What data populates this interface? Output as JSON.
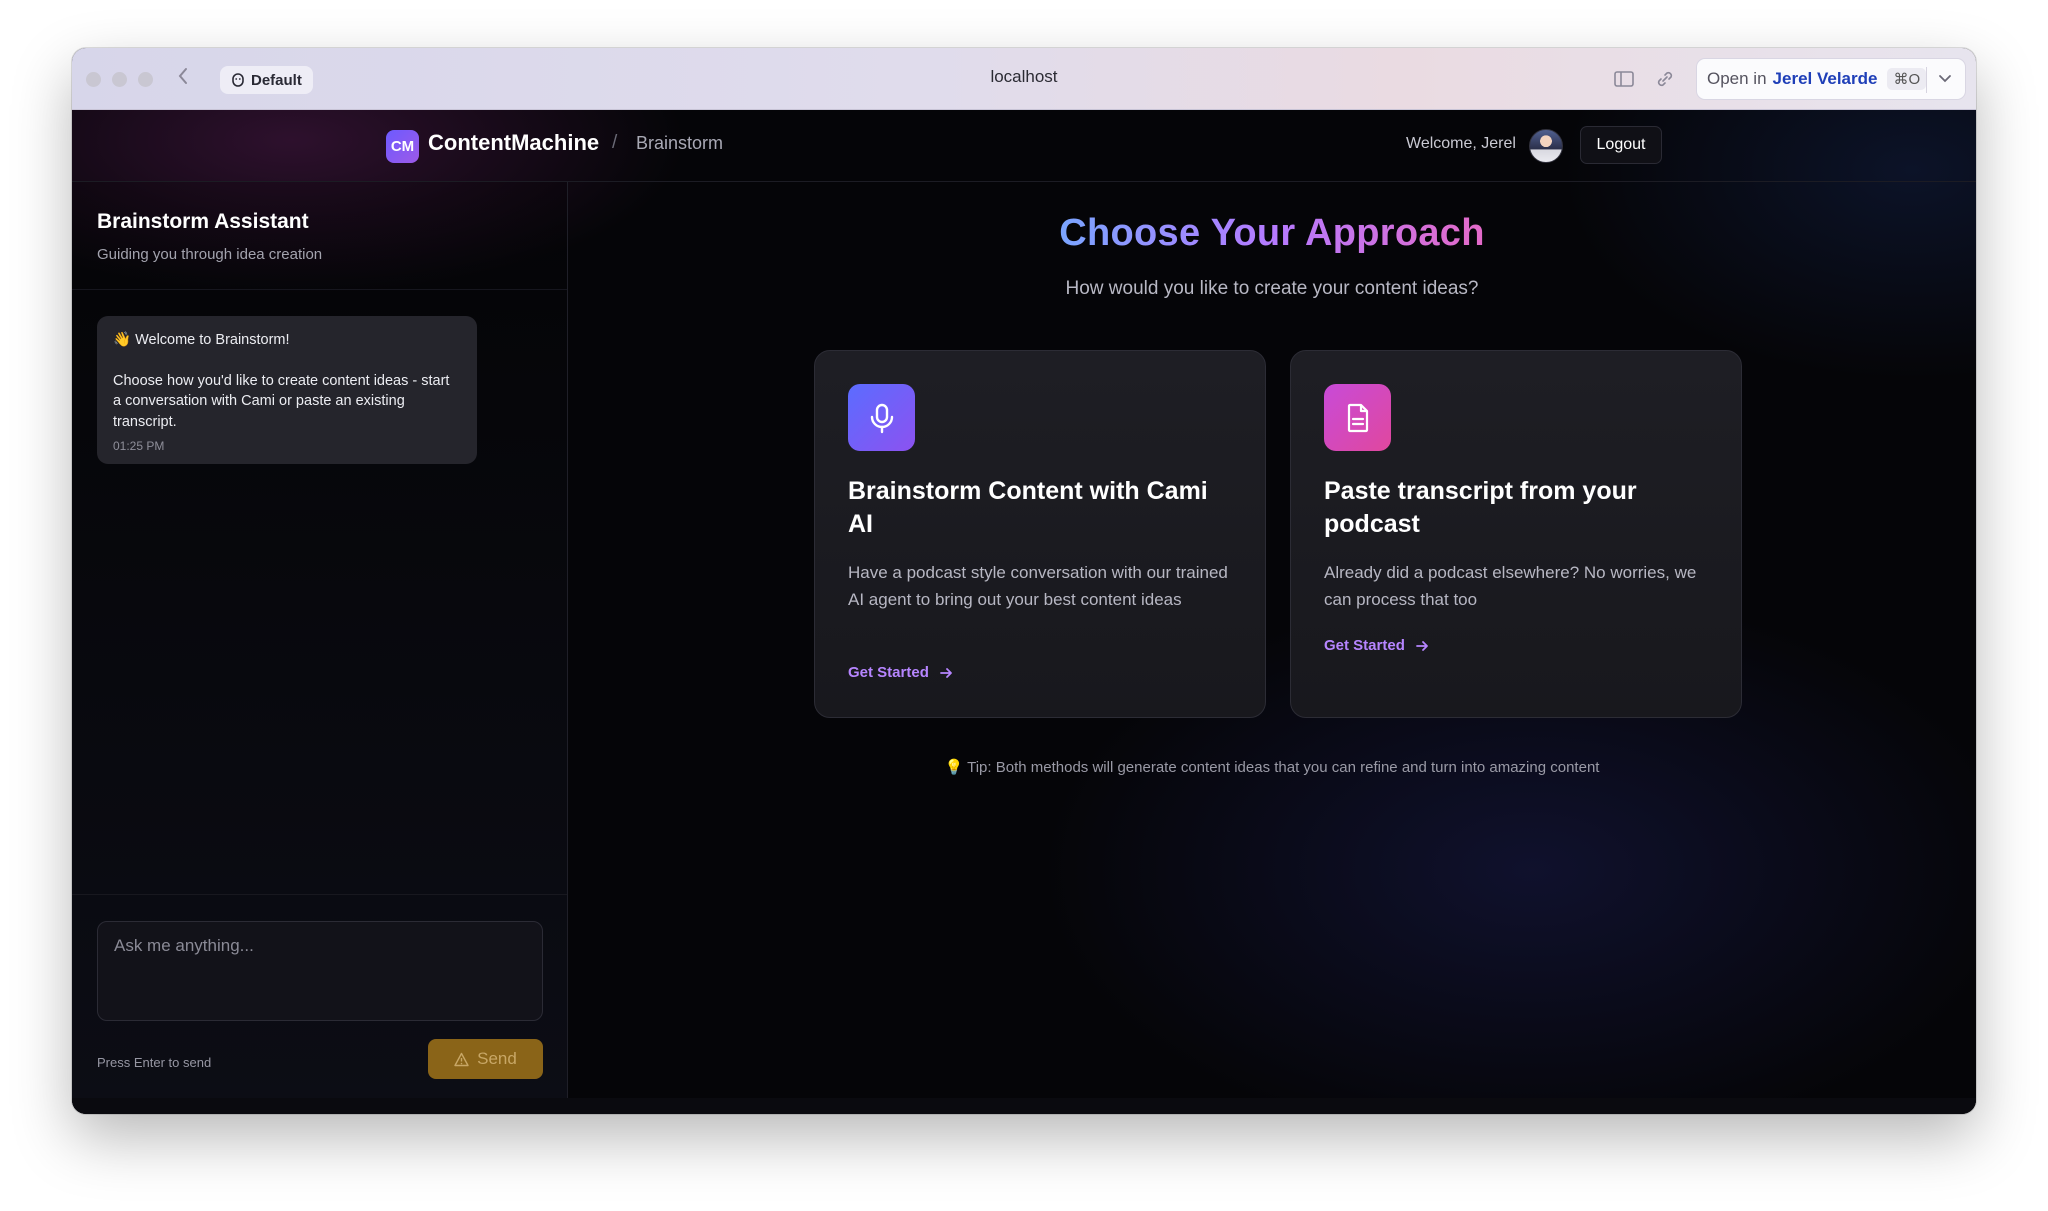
{
  "browser": {
    "profile_label": "Default",
    "url": "localhost",
    "open_in_prefix": "Open in",
    "open_in_name": "Jerel Velarde",
    "open_in_shortcut": "⌘O"
  },
  "header": {
    "logo_text": "CM",
    "brand": "ContentMachine",
    "separator": "/",
    "crumb": "Brainstorm",
    "welcome": "Welcome, Jerel",
    "logout_label": "Logout"
  },
  "sidebar": {
    "title": "Brainstorm Assistant",
    "subtitle": "Guiding you through idea creation",
    "message": {
      "title": "👋 Welcome to Brainstorm!",
      "body": "Choose how you'd like to create content ideas - start a conversation with Cami or paste an existing transcript.",
      "time": "01:25 PM"
    },
    "input_placeholder": "Ask me anything...",
    "hint": "Press Enter to send",
    "send_label": "Send"
  },
  "main": {
    "title": "Choose Your Approach",
    "subtitle": "How would you like to create your content ideas?",
    "cards": [
      {
        "icon": "microphone-icon",
        "title": "Brainstorm Content with Cami AI",
        "description": "Have a podcast style conversation with our trained AI agent to bring out your best content ideas",
        "cta": "Get Started",
        "accent": "#6d5bff"
      },
      {
        "icon": "document-icon",
        "title": "Paste transcript from your podcast",
        "description": "Already did a podcast elsewhere? No worries, we can process that too",
        "cta": "Get Started",
        "accent": "#d64bc0"
      }
    ],
    "tip": "💡 Tip: Both methods will generate content ideas that you can refine and turn into amazing content"
  },
  "colors": {
    "accent_purple": "#b685ff",
    "send_button": "#8a6418",
    "background": "#050508"
  }
}
